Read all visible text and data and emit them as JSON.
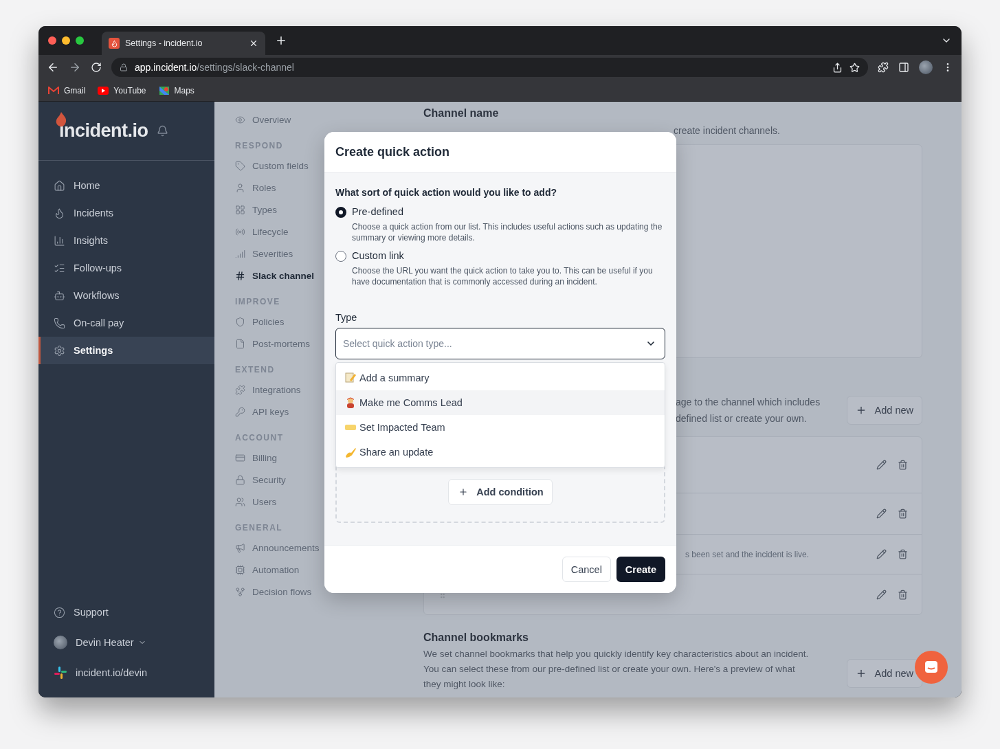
{
  "browser": {
    "tabs": [
      {
        "title": "Settings - incident.io",
        "selected": true
      }
    ],
    "url_host": "app.incident.io",
    "url_path": "/settings/slack-channel",
    "bookmarks": [
      "Gmail",
      "YouTube",
      "Maps"
    ]
  },
  "sidebar": {
    "logo": "incident.io",
    "items": [
      {
        "label": "Home",
        "selected": false
      },
      {
        "label": "Incidents",
        "selected": false
      },
      {
        "label": "Insights",
        "selected": false
      },
      {
        "label": "Follow-ups",
        "selected": false
      },
      {
        "label": "Workflows",
        "selected": false
      },
      {
        "label": "On-call pay",
        "selected": false
      },
      {
        "label": "Settings",
        "selected": true
      }
    ],
    "support": "Support",
    "user": "Devin Heater",
    "workspace": "incident.io/devin"
  },
  "settings_nav": [
    {
      "items": [
        {
          "label": "Overview",
          "selected": false
        }
      ]
    },
    {
      "heading": "RESPOND",
      "items": [
        {
          "label": "Custom fields",
          "selected": false
        },
        {
          "label": "Roles",
          "selected": false
        },
        {
          "label": "Types",
          "selected": false
        },
        {
          "label": "Lifecycle",
          "selected": false
        },
        {
          "label": "Severities",
          "selected": false
        },
        {
          "label": "Slack channel",
          "selected": true
        }
      ]
    },
    {
      "heading": "IMPROVE",
      "items": [
        {
          "label": "Policies",
          "selected": false
        },
        {
          "label": "Post-mortems",
          "selected": false
        }
      ]
    },
    {
      "heading": "EXTEND",
      "items": [
        {
          "label": "Integrations",
          "selected": false
        },
        {
          "label": "API keys",
          "selected": false
        }
      ]
    },
    {
      "heading": "ACCOUNT",
      "items": [
        {
          "label": "Billing",
          "selected": false
        },
        {
          "label": "Security",
          "selected": false
        },
        {
          "label": "Users",
          "selected": false
        }
      ]
    },
    {
      "heading": "GENERAL",
      "items": [
        {
          "label": "Announcements",
          "selected": false
        },
        {
          "label": "Automation",
          "selected": false
        },
        {
          "label": "Decision flows",
          "selected": false
        }
      ]
    }
  ],
  "content": {
    "channel_name": {
      "title": "Channel name",
      "description": "create incident channels."
    },
    "quick_actions": {
      "description_lines": [
        "age to the channel which includes",
        "defined list or create your own."
      ],
      "add_button": "Add new",
      "rows": [
        {
          "text": ""
        },
        {
          "text": ""
        },
        {
          "text": "s been set and the incident is live."
        },
        {
          "text": ""
        }
      ]
    },
    "bookmarks": {
      "title": "Channel bookmarks",
      "description": "We set channel bookmarks that help you quickly identify key characteristics about an incident. You can select these from our pre-defined list or create your own. Here's a preview of what they might look like:",
      "add_button": "Add new"
    }
  },
  "modal": {
    "title": "Create quick action",
    "question": "What sort of quick action would you like to add?",
    "options": [
      {
        "label": "Pre-defined",
        "description": "Choose a quick action from our list. This includes useful actions such as updating the summary or viewing more details.",
        "selected": true
      },
      {
        "label": "Custom link",
        "description": "Choose the URL you want the quick action to take you to. This can be useful if you have documentation that is commonly accessed during an incident.",
        "selected": false
      }
    ],
    "type_label": "Type",
    "type_placeholder": "Select quick action type...",
    "dropdown": [
      {
        "label": "Add a summary",
        "highlighted": false
      },
      {
        "label": "Make me Comms Lead",
        "highlighted": true
      },
      {
        "label": "Set Impacted Team",
        "highlighted": false
      },
      {
        "label": "Share an update",
        "highlighted": false
      }
    ],
    "add_condition": "Add condition",
    "buttons": {
      "cancel": "Cancel",
      "create": "Create"
    }
  }
}
